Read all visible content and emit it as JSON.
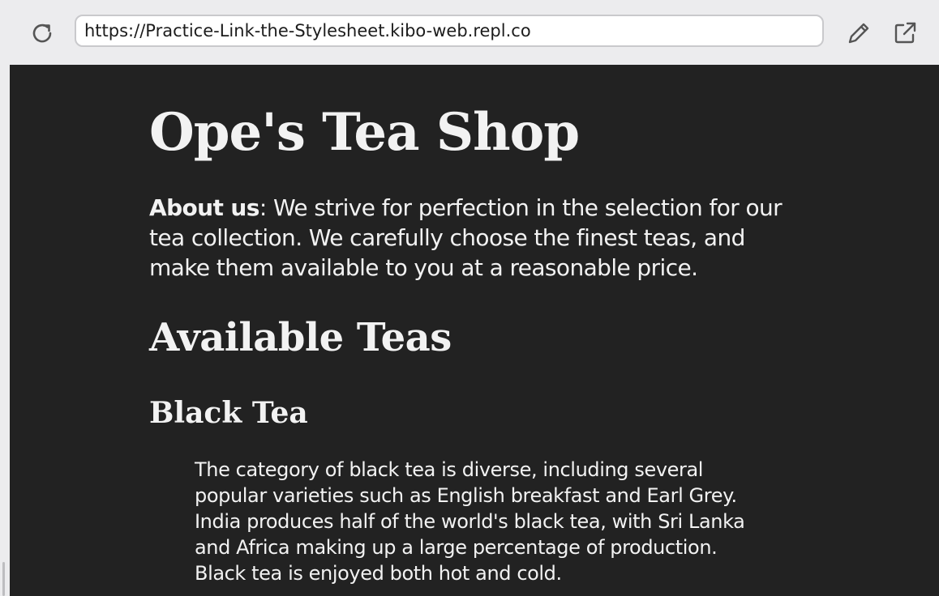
{
  "browser": {
    "url": "https://Practice-Link-the-Stylesheet.kibo-web.repl.co",
    "icons": {
      "reload": "reload-icon",
      "edit": "pencil-icon",
      "open": "open-in-new-tab-icon"
    }
  },
  "page": {
    "title": "Ope's Tea Shop",
    "about_label": "About us",
    "about_text": ": We strive for perfection in the selection for our tea collection. We carefully choose the finest teas, and make them available to you at a reasonable price.",
    "section_title": "Available Teas",
    "teas": [
      {
        "name": "Black Tea",
        "description": "The category of black tea is diverse, including several popular varieties such as English breakfast and Earl Grey. India produces half of the world's black tea, with Sri Lanka and Africa making up a large percentage of production. Black tea is enjoyed both hot and cold."
      }
    ]
  },
  "colors": {
    "page_background": "#222222",
    "text": "#f2f2f2",
    "chrome_background": "#ececee"
  }
}
